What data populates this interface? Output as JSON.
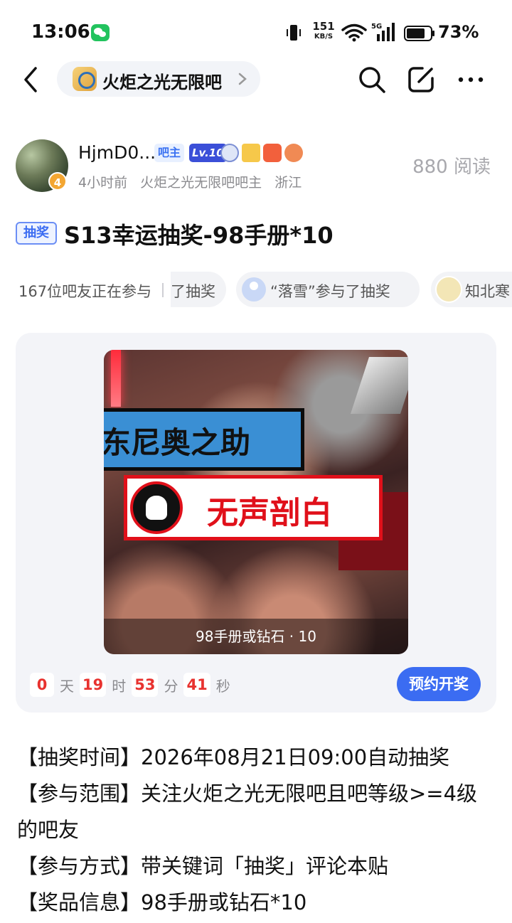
{
  "status_bar": {
    "time": "13:06",
    "net_speed_value": "151",
    "net_speed_unit": "KB/S",
    "network": "5G",
    "battery": "73%"
  },
  "nav": {
    "forum_name": "火炬之光无限吧",
    "icons": [
      "back-icon",
      "search-icon",
      "edit-icon",
      "more-icon"
    ]
  },
  "author": {
    "name": "HjmD0...",
    "badge_role": "吧主",
    "badge_level": "Lv.10",
    "avatar_level": "4",
    "time_ago": "4小时前",
    "role_desc": "火炬之光无限吧吧主",
    "location": "浙江",
    "read_count": "880 阅读"
  },
  "post": {
    "tag": "抽奖",
    "title": "S13幸运抽奖-98手册*10"
  },
  "participants": {
    "count_text": "167位吧友正在参与",
    "chips": [
      "了抽奖",
      "“落雪”参与了抽奖",
      "知北寒"
    ]
  },
  "lottery": {
    "image_text_1": "东尼奥之助",
    "image_text_2": "无声剖白",
    "prize_caption": "98手册或钻石 · 10",
    "countdown": {
      "days": "0",
      "days_unit": "天",
      "hours": "19",
      "hours_unit": "时",
      "minutes": "53",
      "minutes_unit": "分",
      "seconds": "41",
      "seconds_unit": "秒"
    },
    "reserve_button": "预约开奖",
    "accent_color": "#3b6cf2",
    "countdown_color": "#e8322f"
  },
  "content": {
    "line1": "【抽奖时间】2026年08月21日09:00自动抽奖",
    "line2": "【参与范围】关注火炬之光无限吧且吧等级>=4级的吧友",
    "line3": "【参与方式】带关键词「抽奖」评论本贴",
    "line4": "【奖品信息】98手册或钻石*10"
  }
}
